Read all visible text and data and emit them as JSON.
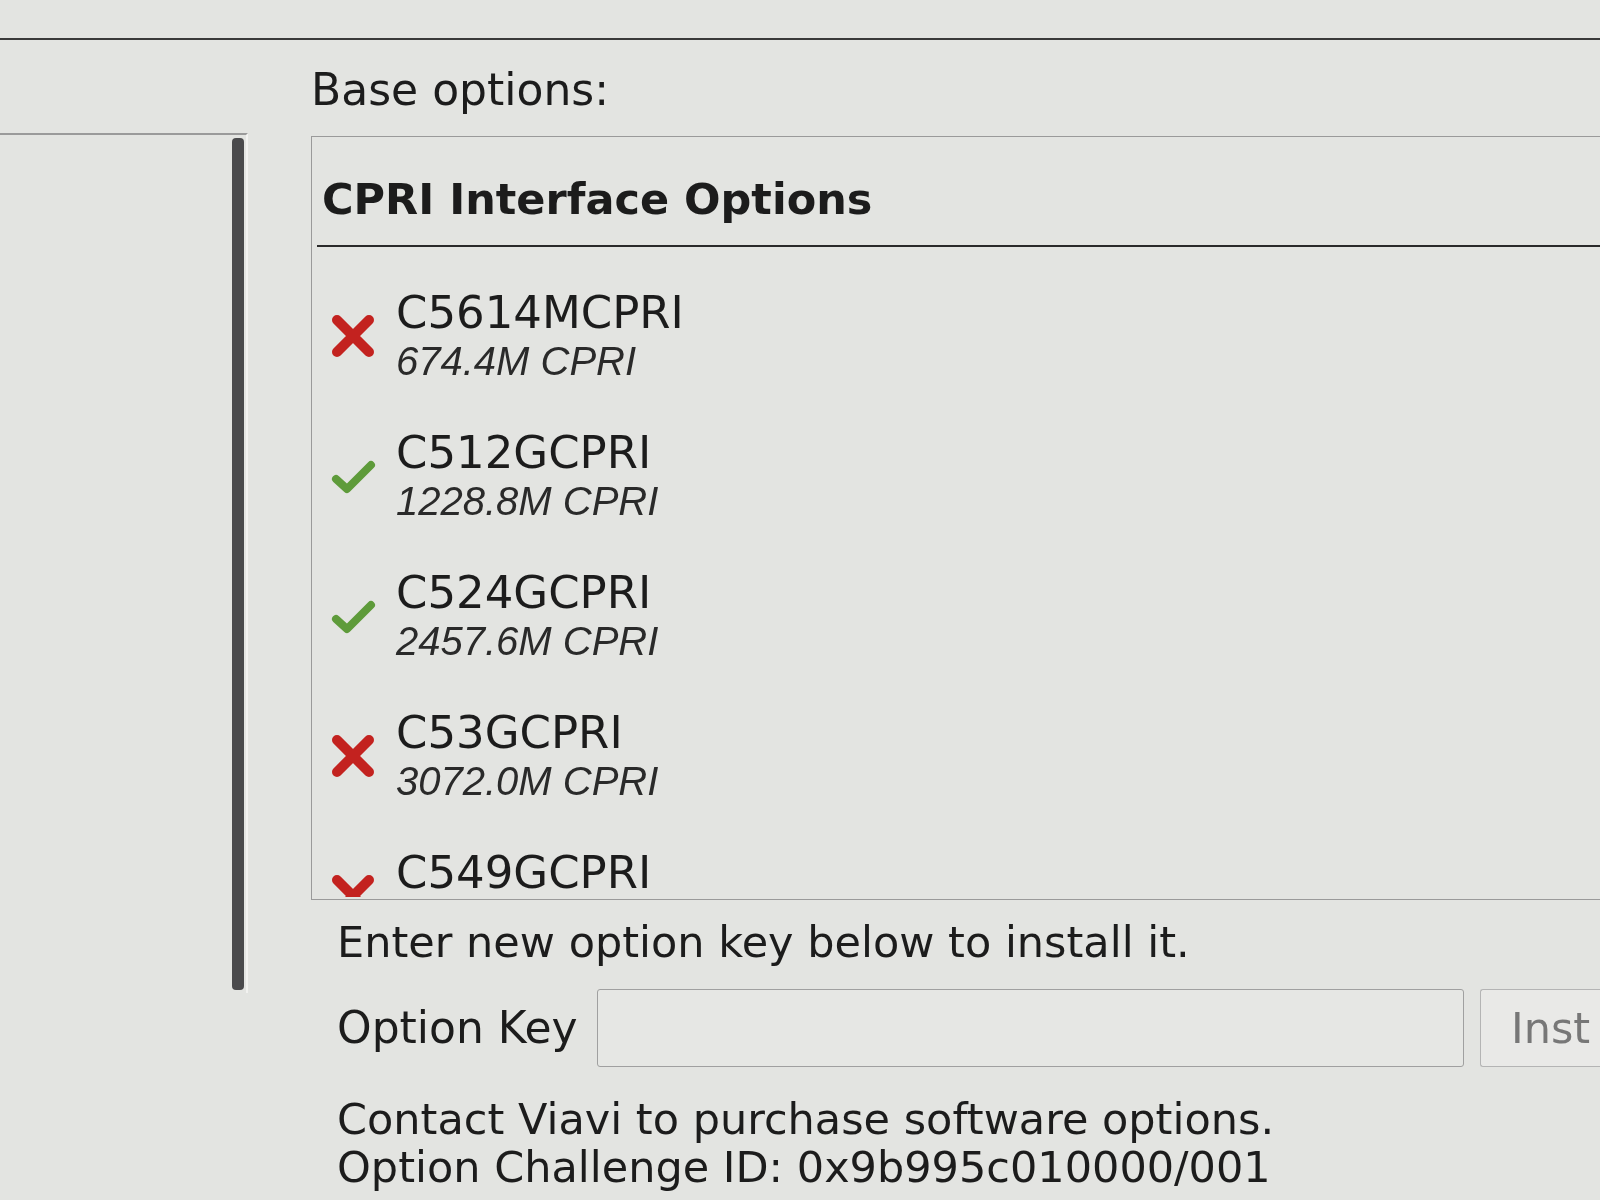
{
  "base_options": {
    "label": "Base options:"
  },
  "options_list": {
    "title": "CPRI Interface Options",
    "items": [
      {
        "name": "C5614MCPRI",
        "rate": "674.4M CPRI",
        "installed": false
      },
      {
        "name": "C512GCPRI",
        "rate": "1228.8M CPRI",
        "installed": true
      },
      {
        "name": "C524GCPRI",
        "rate": "2457.6M CPRI",
        "installed": true
      },
      {
        "name": "C53GCPRI",
        "rate": "3072.0M CPRI",
        "installed": false
      },
      {
        "name": "C549GCPRI",
        "installed": false
      }
    ]
  },
  "install": {
    "prompt": "Enter new option key below to install it.",
    "key_label": "Option Key",
    "button": {
      "label": "Inst",
      "disabled": true
    }
  },
  "contact": "Contact Viavi to purchase software options.",
  "challenge_id": "Option Challenge ID: 0x9b995c010000/001"
}
